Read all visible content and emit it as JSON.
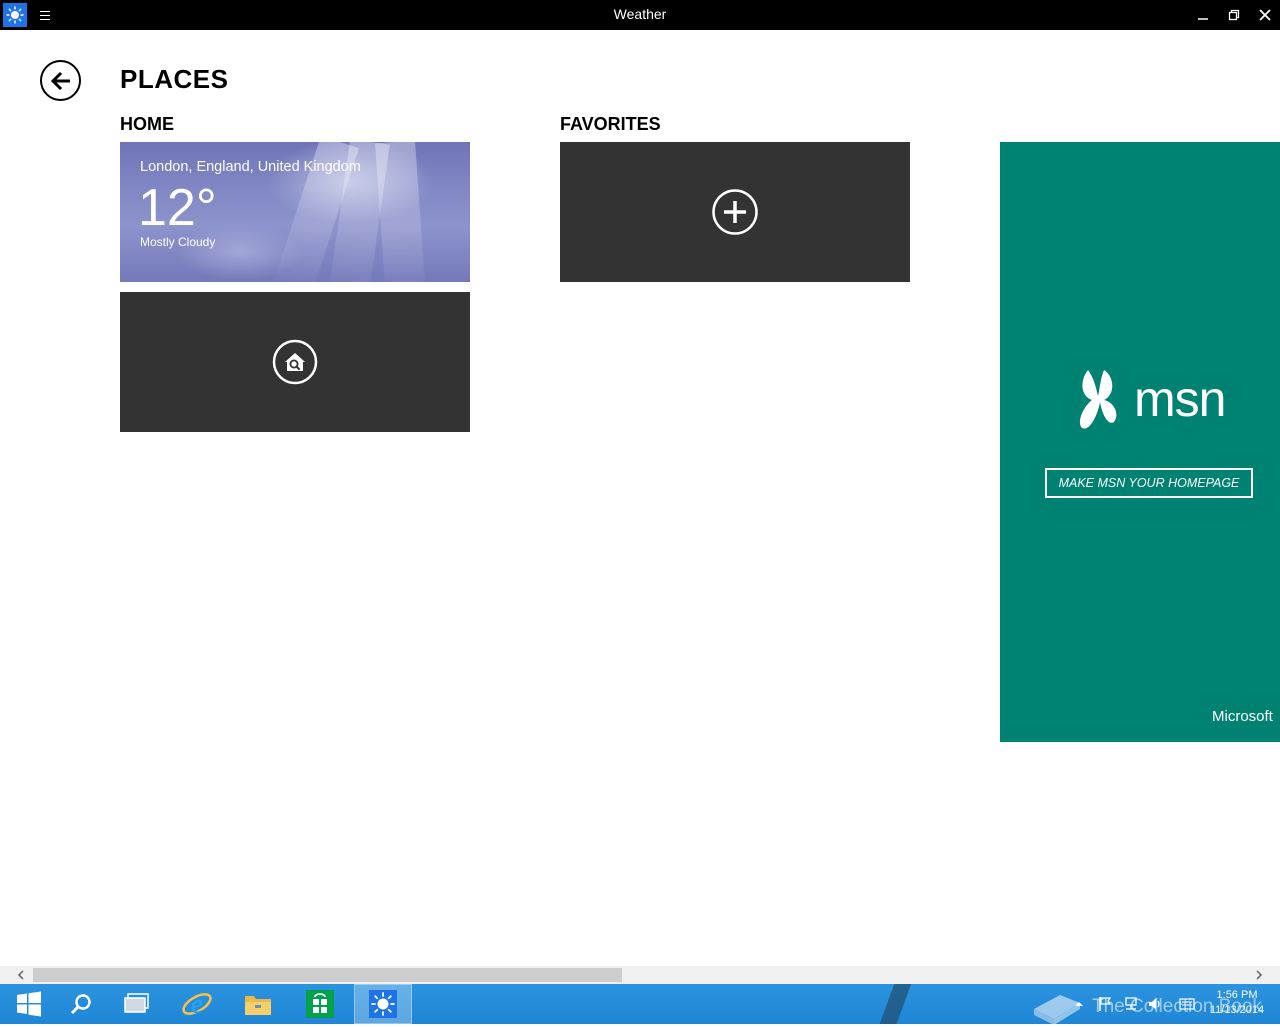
{
  "window": {
    "title": "Weather",
    "icons": {
      "app": "weather-sun-icon",
      "menu": "hamburger-menu-icon",
      "minimize": "minimize-icon",
      "maximize": "restore-icon",
      "close": "close-icon"
    }
  },
  "page": {
    "title": "PLACES",
    "back_icon": "back-arrow-icon"
  },
  "sections": {
    "home": {
      "title": "HOME"
    },
    "favorites": {
      "title": "FAVORITES"
    }
  },
  "tiles": {
    "home_weather": {
      "location": "London, England, United Kingdom",
      "temperature": "12°",
      "condition": "Mostly Cloudy"
    },
    "search_home": {
      "icon": "home-search-icon"
    },
    "add_favorite": {
      "icon": "add-circle-icon"
    }
  },
  "ad": {
    "brand": "msn",
    "cta": "MAKE MSN YOUR HOMEPAGE",
    "footer": "Microsoft",
    "color": "#008272"
  },
  "taskbar": {
    "apps": [
      "start-icon",
      "search-icon",
      "task-view-icon",
      "internet-explorer-icon",
      "file-explorer-icon",
      "store-icon",
      "weather-sun-icon"
    ],
    "watermark": "The Collection Book",
    "time": "1:56 PM",
    "date": "11/13/2014",
    "color": "#1f86d6"
  }
}
